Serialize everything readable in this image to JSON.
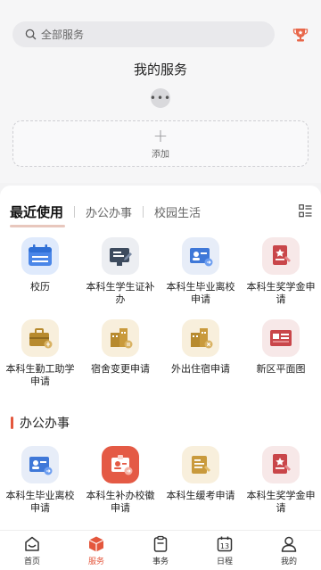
{
  "search": {
    "placeholder": "全部服务"
  },
  "my_services": {
    "title": "我的服务",
    "more_glyph": "•••",
    "add_label": "添加"
  },
  "tabs": [
    {
      "label": "最近使用",
      "active": true
    },
    {
      "label": "办公办事",
      "active": false
    },
    {
      "label": "校园生活",
      "active": false
    }
  ],
  "recent": [
    {
      "label": "校历",
      "icon": "calendar-icon",
      "bg": "#e4eefc"
    },
    {
      "label": "本科生学生证补办",
      "icon": "id-card-icon",
      "bg": "#eceef2"
    },
    {
      "label": "本科生毕业离校申请",
      "icon": "graduation-card-icon",
      "bg": "#e7edf8"
    },
    {
      "label": "本科生奖学金申请",
      "icon": "award-doc-icon",
      "bg": "#f7e8e8"
    },
    {
      "label": "本科生勤工助学申请",
      "icon": "briefcase-icon",
      "bg": "#f8efdc"
    },
    {
      "label": "宿舍变更申请",
      "icon": "dorm-change-icon",
      "bg": "#f8efdc"
    },
    {
      "label": "外出住宿申请",
      "icon": "dorm-out-icon",
      "bg": "#f8efdc"
    },
    {
      "label": "新区平面图",
      "icon": "map-card-icon",
      "bg": "#f7e8e8"
    }
  ],
  "office": {
    "title": "办公办事",
    "items": [
      {
        "label": "本科生毕业离校申请",
        "icon": "graduation-card-icon",
        "bg": "#e7edf8"
      },
      {
        "label": "本科生补办校徽申请",
        "icon": "badge-icon",
        "bg": "#f7e1dd"
      },
      {
        "label": "本科生缓考申请",
        "icon": "exam-doc-icon",
        "bg": "#f8efdc"
      },
      {
        "label": "本科生奖学金申请",
        "icon": "award-doc-icon",
        "bg": "#f7e8e8"
      }
    ]
  },
  "tabbar": [
    {
      "label": "首页",
      "icon": "home-icon",
      "active": false
    },
    {
      "label": "服务",
      "icon": "service-cube-icon",
      "active": true
    },
    {
      "label": "事务",
      "icon": "clipboard-icon",
      "active": false
    },
    {
      "label": "日程",
      "icon": "calendar-13-icon",
      "active": false,
      "day": "13"
    },
    {
      "label": "我的",
      "icon": "user-icon",
      "active": false
    }
  ],
  "colors": {
    "accent": "#e4573d",
    "blue": "#3f78d8",
    "gold": "#c79a3a",
    "red": "#d9534f"
  }
}
